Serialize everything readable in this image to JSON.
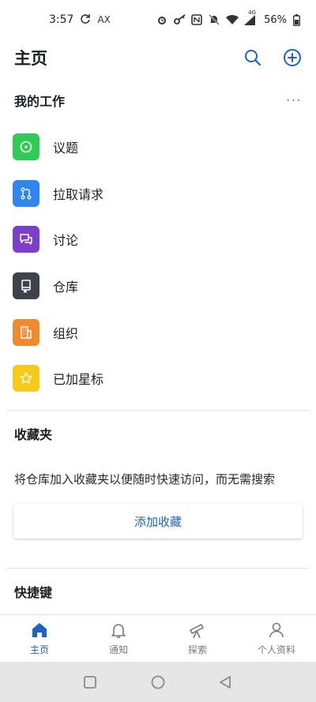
{
  "status_bar": {
    "time": "3:57",
    "sync_icon": "sync-icon",
    "carrier_text": "AX",
    "network_text": "4G",
    "battery": "56%"
  },
  "header": {
    "title": "主页",
    "search_icon": "search-icon",
    "add_icon": "plus-circle-icon",
    "accent_color": "#1a63c7"
  },
  "my_work": {
    "heading": "我的工作",
    "more": "···",
    "items": [
      {
        "label": "议题",
        "icon": "issue-icon",
        "color": "#2ecc55"
      },
      {
        "label": "拉取请求",
        "icon": "pull-request-icon",
        "color": "#2f86ee"
      },
      {
        "label": "讨论",
        "icon": "discussion-icon",
        "color": "#7d3ec9"
      },
      {
        "label": "仓库",
        "icon": "repository-icon",
        "color": "#3d424b"
      },
      {
        "label": "组织",
        "icon": "organization-icon",
        "color": "#f08a2f"
      },
      {
        "label": "已加星标",
        "icon": "star-icon",
        "color": "#f7c918"
      }
    ]
  },
  "favorites": {
    "heading": "收藏夹",
    "description": "将仓库加入收藏夹以便随时快速访问，而无需搜索",
    "button": "添加收藏"
  },
  "shortcuts": {
    "heading": "快捷键"
  },
  "tab_bar": {
    "tabs": [
      {
        "label": "主页",
        "icon": "home-icon",
        "active": true
      },
      {
        "label": "通知",
        "icon": "bell-icon",
        "active": false
      },
      {
        "label": "探索",
        "icon": "telescope-icon",
        "active": false
      },
      {
        "label": "个人资料",
        "icon": "person-icon",
        "active": false
      }
    ]
  },
  "system_nav": {
    "recents_icon": "recents-icon",
    "home_icon": "home-circle-icon",
    "back_icon": "back-triangle-icon"
  }
}
